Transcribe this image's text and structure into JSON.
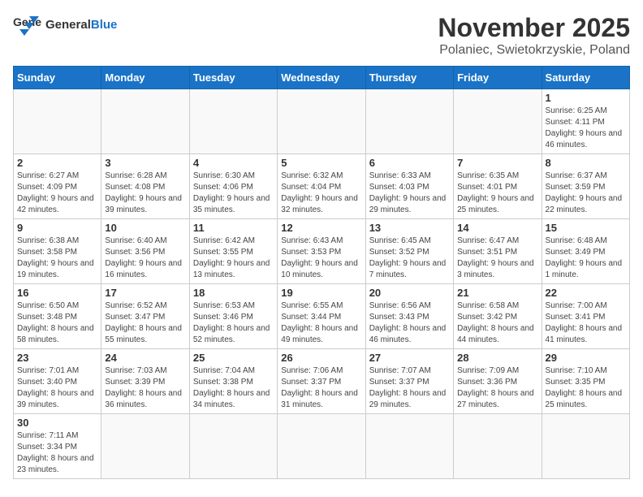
{
  "header": {
    "logo_general": "General",
    "logo_blue": "Blue",
    "month": "November 2025",
    "location": "Polaniec, Swietokrzyskie, Poland"
  },
  "weekdays": [
    "Sunday",
    "Monday",
    "Tuesday",
    "Wednesday",
    "Thursday",
    "Friday",
    "Saturday"
  ],
  "weeks": [
    [
      {
        "day": "",
        "info": ""
      },
      {
        "day": "",
        "info": ""
      },
      {
        "day": "",
        "info": ""
      },
      {
        "day": "",
        "info": ""
      },
      {
        "day": "",
        "info": ""
      },
      {
        "day": "",
        "info": ""
      },
      {
        "day": "1",
        "info": "Sunrise: 6:25 AM\nSunset: 4:11 PM\nDaylight: 9 hours and 46 minutes."
      }
    ],
    [
      {
        "day": "2",
        "info": "Sunrise: 6:27 AM\nSunset: 4:09 PM\nDaylight: 9 hours and 42 minutes."
      },
      {
        "day": "3",
        "info": "Sunrise: 6:28 AM\nSunset: 4:08 PM\nDaylight: 9 hours and 39 minutes."
      },
      {
        "day": "4",
        "info": "Sunrise: 6:30 AM\nSunset: 4:06 PM\nDaylight: 9 hours and 35 minutes."
      },
      {
        "day": "5",
        "info": "Sunrise: 6:32 AM\nSunset: 4:04 PM\nDaylight: 9 hours and 32 minutes."
      },
      {
        "day": "6",
        "info": "Sunrise: 6:33 AM\nSunset: 4:03 PM\nDaylight: 9 hours and 29 minutes."
      },
      {
        "day": "7",
        "info": "Sunrise: 6:35 AM\nSunset: 4:01 PM\nDaylight: 9 hours and 25 minutes."
      },
      {
        "day": "8",
        "info": "Sunrise: 6:37 AM\nSunset: 3:59 PM\nDaylight: 9 hours and 22 minutes."
      }
    ],
    [
      {
        "day": "9",
        "info": "Sunrise: 6:38 AM\nSunset: 3:58 PM\nDaylight: 9 hours and 19 minutes."
      },
      {
        "day": "10",
        "info": "Sunrise: 6:40 AM\nSunset: 3:56 PM\nDaylight: 9 hours and 16 minutes."
      },
      {
        "day": "11",
        "info": "Sunrise: 6:42 AM\nSunset: 3:55 PM\nDaylight: 9 hours and 13 minutes."
      },
      {
        "day": "12",
        "info": "Sunrise: 6:43 AM\nSunset: 3:53 PM\nDaylight: 9 hours and 10 minutes."
      },
      {
        "day": "13",
        "info": "Sunrise: 6:45 AM\nSunset: 3:52 PM\nDaylight: 9 hours and 7 minutes."
      },
      {
        "day": "14",
        "info": "Sunrise: 6:47 AM\nSunset: 3:51 PM\nDaylight: 9 hours and 3 minutes."
      },
      {
        "day": "15",
        "info": "Sunrise: 6:48 AM\nSunset: 3:49 PM\nDaylight: 9 hours and 1 minute."
      }
    ],
    [
      {
        "day": "16",
        "info": "Sunrise: 6:50 AM\nSunset: 3:48 PM\nDaylight: 8 hours and 58 minutes."
      },
      {
        "day": "17",
        "info": "Sunrise: 6:52 AM\nSunset: 3:47 PM\nDaylight: 8 hours and 55 minutes."
      },
      {
        "day": "18",
        "info": "Sunrise: 6:53 AM\nSunset: 3:46 PM\nDaylight: 8 hours and 52 minutes."
      },
      {
        "day": "19",
        "info": "Sunrise: 6:55 AM\nSunset: 3:44 PM\nDaylight: 8 hours and 49 minutes."
      },
      {
        "day": "20",
        "info": "Sunrise: 6:56 AM\nSunset: 3:43 PM\nDaylight: 8 hours and 46 minutes."
      },
      {
        "day": "21",
        "info": "Sunrise: 6:58 AM\nSunset: 3:42 PM\nDaylight: 8 hours and 44 minutes."
      },
      {
        "day": "22",
        "info": "Sunrise: 7:00 AM\nSunset: 3:41 PM\nDaylight: 8 hours and 41 minutes."
      }
    ],
    [
      {
        "day": "23",
        "info": "Sunrise: 7:01 AM\nSunset: 3:40 PM\nDaylight: 8 hours and 39 minutes."
      },
      {
        "day": "24",
        "info": "Sunrise: 7:03 AM\nSunset: 3:39 PM\nDaylight: 8 hours and 36 minutes."
      },
      {
        "day": "25",
        "info": "Sunrise: 7:04 AM\nSunset: 3:38 PM\nDaylight: 8 hours and 34 minutes."
      },
      {
        "day": "26",
        "info": "Sunrise: 7:06 AM\nSunset: 3:37 PM\nDaylight: 8 hours and 31 minutes."
      },
      {
        "day": "27",
        "info": "Sunrise: 7:07 AM\nSunset: 3:37 PM\nDaylight: 8 hours and 29 minutes."
      },
      {
        "day": "28",
        "info": "Sunrise: 7:09 AM\nSunset: 3:36 PM\nDaylight: 8 hours and 27 minutes."
      },
      {
        "day": "29",
        "info": "Sunrise: 7:10 AM\nSunset: 3:35 PM\nDaylight: 8 hours and 25 minutes."
      }
    ],
    [
      {
        "day": "30",
        "info": "Sunrise: 7:11 AM\nSunset: 3:34 PM\nDaylight: 8 hours and 23 minutes."
      },
      {
        "day": "",
        "info": ""
      },
      {
        "day": "",
        "info": ""
      },
      {
        "day": "",
        "info": ""
      },
      {
        "day": "",
        "info": ""
      },
      {
        "day": "",
        "info": ""
      },
      {
        "day": "",
        "info": ""
      }
    ]
  ]
}
